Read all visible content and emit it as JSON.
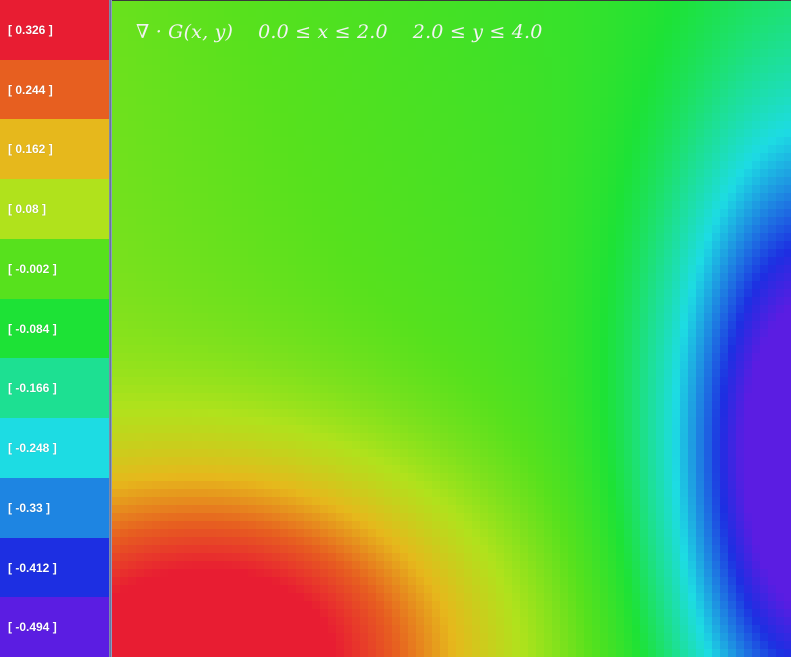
{
  "chart_data": {
    "type": "heatmap",
    "title": "∇ · G(x, y)    0.0 ≤ x ≤ 2.0    2.0 ≤ y ≤ 4.0",
    "xlim": [
      0.0,
      2.0
    ],
    "ylim": [
      2.0,
      4.0
    ],
    "legend_position": "left",
    "legend": [
      {
        "label": "[ 0.326 ]",
        "value": 0.326,
        "color": "#e81d32"
      },
      {
        "label": "[ 0.244 ]",
        "value": 0.244,
        "color": "#e75f20"
      },
      {
        "label": "[ 0.162 ]",
        "value": 0.162,
        "color": "#e6b81c"
      },
      {
        "label": "[ 0.08 ]",
        "value": 0.08,
        "color": "#b0e21c"
      },
      {
        "label": "[ -0.002 ]",
        "value": -0.002,
        "color": "#57e11d"
      },
      {
        "label": "[ -0.084 ]",
        "value": -0.084,
        "color": "#1de236"
      },
      {
        "label": "[ -0.166 ]",
        "value": -0.166,
        "color": "#1de092"
      },
      {
        "label": "[ -0.248 ]",
        "value": -0.248,
        "color": "#1ddce3"
      },
      {
        "label": "[ -0.33 ]",
        "value": -0.33,
        "color": "#1e85e2"
      },
      {
        "label": "[ -0.412 ]",
        "value": -0.412,
        "color": "#1d2fe2"
      },
      {
        "label": "[ -0.494 ]",
        "value": -0.494,
        "color": "#5b1de2"
      }
    ],
    "field_features": [
      {
        "kind": "maximum",
        "x": 0.32,
        "y": 2.0,
        "value": 0.33
      },
      {
        "kind": "minimum",
        "x": 2.0,
        "y": 2.6,
        "value": -0.49
      }
    ]
  }
}
